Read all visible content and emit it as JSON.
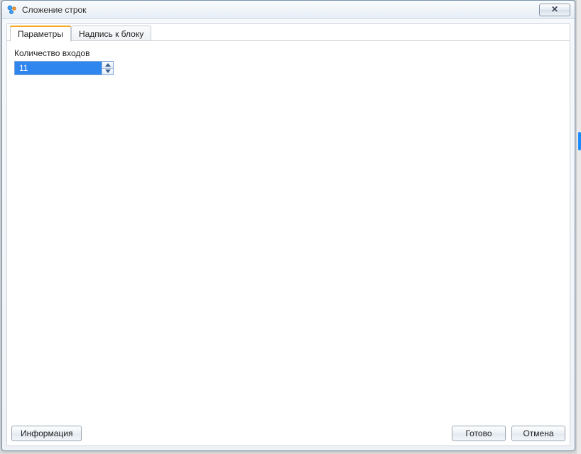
{
  "window": {
    "title": "Сложение строк"
  },
  "tabs": [
    {
      "label": "Параметры",
      "active": true
    },
    {
      "label": "Надпись к блоку",
      "active": false
    }
  ],
  "params": {
    "inputs_count_label": "Количество входов",
    "inputs_count_value": "11"
  },
  "buttons": {
    "info": "Информация",
    "ok": "Готово",
    "cancel": "Отмена"
  }
}
